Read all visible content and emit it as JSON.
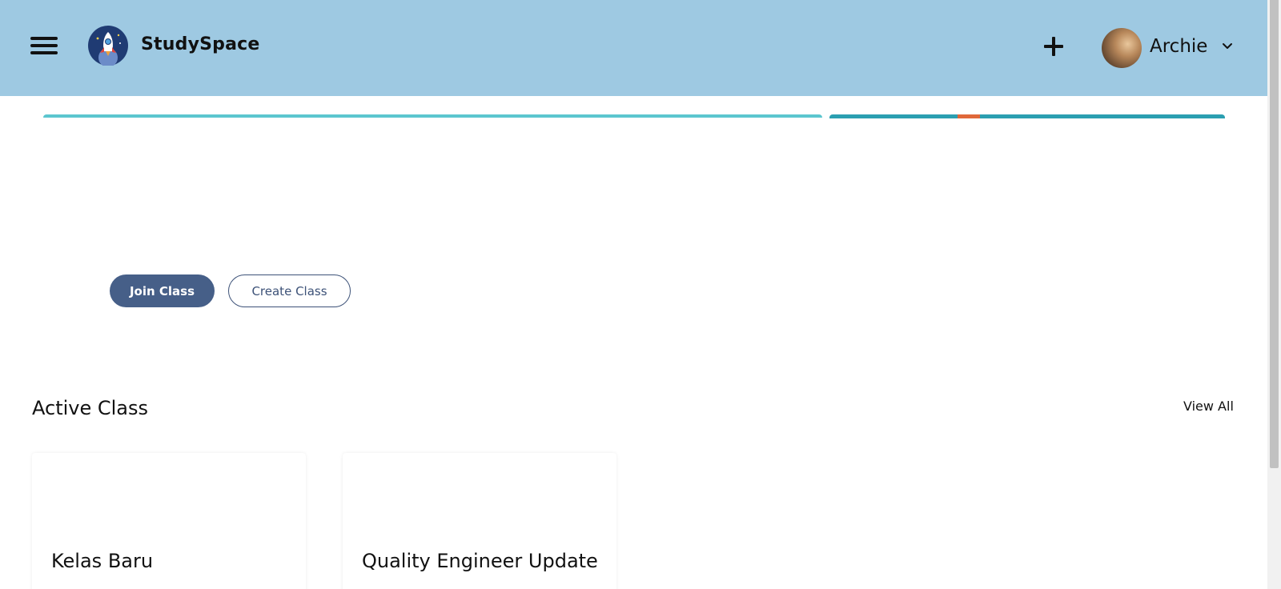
{
  "app": {
    "brand": "StudySpace"
  },
  "header": {
    "user_name": "Archie"
  },
  "actions": {
    "join_label": "Join Class",
    "create_label": "Create Class"
  },
  "active_section": {
    "title": "Active Class",
    "view_all_label": "View All",
    "classes": [
      {
        "name": "Kelas Baru"
      },
      {
        "name": "Quality Engineer Update"
      }
    ]
  },
  "colors": {
    "header_bg": "#9ec9e2",
    "primary_button": "#465f88",
    "outline_button": "#3d5278"
  }
}
